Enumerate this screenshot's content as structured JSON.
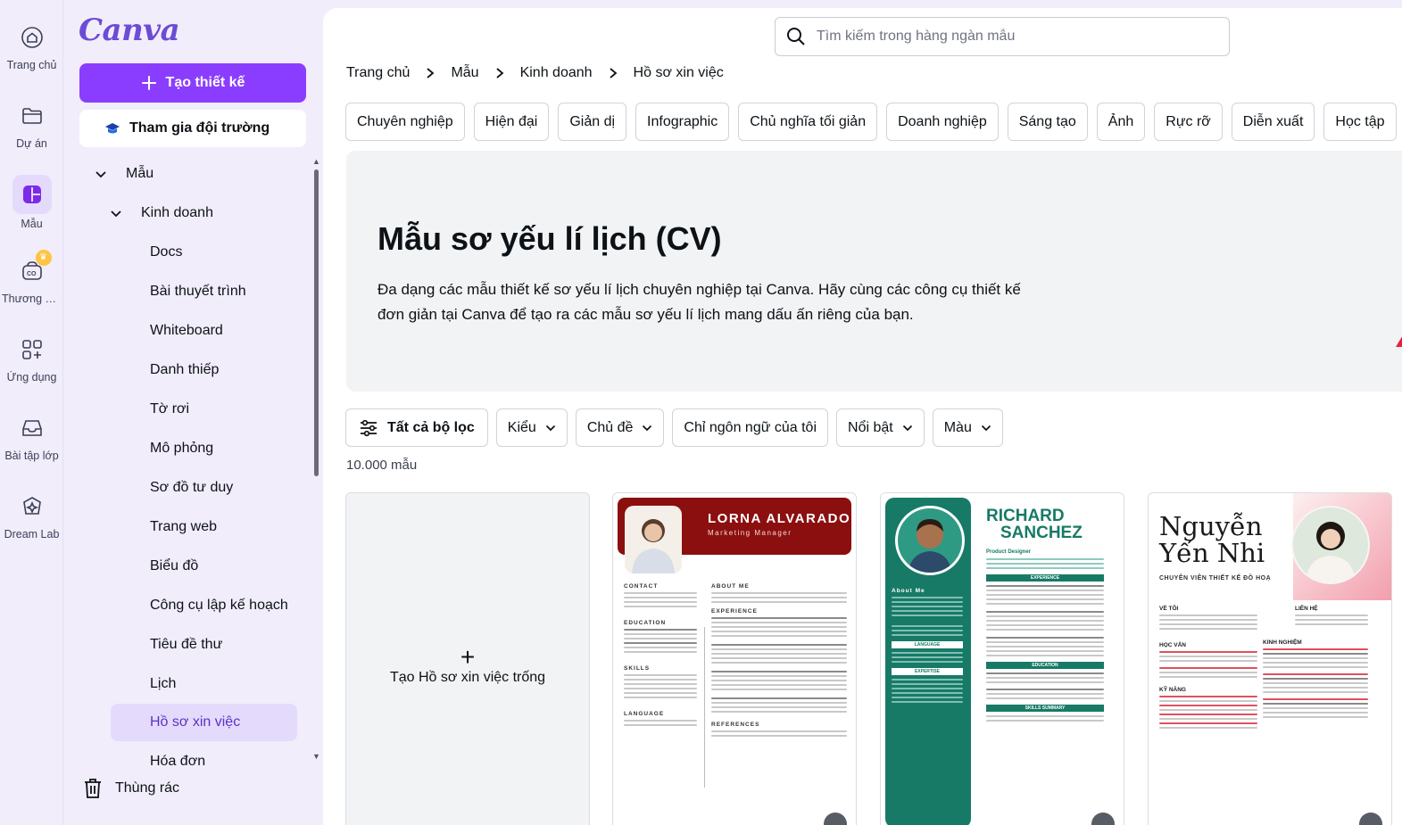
{
  "rail": {
    "items": [
      {
        "label": "Trang chủ",
        "icon": "home-icon"
      },
      {
        "label": "Dự án",
        "icon": "folder-icon"
      },
      {
        "label": "Mẫu",
        "icon": "templates-icon"
      },
      {
        "label": "Thương hi...",
        "icon": "brand-icon"
      },
      {
        "label": "Ứng dụng",
        "icon": "apps-icon"
      },
      {
        "label": "Bài tập lớp",
        "icon": "assignment-icon"
      },
      {
        "label": "Dream Lab",
        "icon": "dream-lab-icon"
      }
    ]
  },
  "sidebar": {
    "logo": "Canva",
    "create_button": "Tạo thiết kế",
    "team_button": "Tham gia đội trường",
    "tree": {
      "root": "Mẫu",
      "group": "Kinh doanh",
      "items": [
        "Docs",
        "Bài thuyết trình",
        "Whiteboard",
        "Danh thiếp",
        "Tờ rơi",
        "Mô phỏng",
        "Sơ đồ tư duy",
        "Trang web",
        "Biểu đồ",
        "Công cụ lập kế hoạch",
        "Tiêu đề thư",
        "Lịch",
        "Hồ sơ xin việc",
        "Hóa đơn"
      ],
      "selected": "Hồ sơ xin việc"
    },
    "trash": "Thùng rác"
  },
  "search": {
    "placeholder": "Tìm kiếm trong hàng ngàn mẫu",
    "value": ""
  },
  "breadcrumb": [
    "Trang chủ",
    "Mẫu",
    "Kinh doanh",
    "Hồ sơ xin việc"
  ],
  "chips": [
    "Chuyên nghiệp",
    "Hiện đại",
    "Giản dị",
    "Infographic",
    "Chủ nghĩa tối giản",
    "Doanh nghiệp",
    "Sáng tạo",
    "Ảnh",
    "Rực rỡ",
    "Diễn xuất",
    "Học tập"
  ],
  "hero": {
    "title": "Mẫu sơ yếu lí lịch (CV)",
    "description": "Đa dạng các mẫu thiết kế sơ yếu lí lịch chuyên nghiệp tại Canva. Hãy cùng các công cụ thiết kế đơn giản tại Canva để tạo ra các mẫu sơ yếu lí lịch mang dấu ấn riêng của bạn."
  },
  "filters": {
    "all": "Tất cả bộ lọc",
    "dropdowns": [
      "Kiểu",
      "Chủ đề"
    ],
    "my_language": "Chỉ ngôn ngữ của tôi",
    "dropdowns2": [
      "Nổi bật",
      "Màu"
    ]
  },
  "count": "10.000 mẫu",
  "cards": {
    "blank_label": "Tạo Hồ sơ xin việc trống",
    "resume1": {
      "name": "LORNA ALVARADO",
      "role": "Marketing Manager",
      "sections_left": [
        "CONTACT",
        "EDUCATION",
        "SKILLS",
        "LANGUAGE"
      ],
      "sections_right": [
        "ABOUT ME",
        "EXPERIENCE",
        "REFERENCES"
      ]
    },
    "resume2": {
      "name_line1": "RICHARD",
      "name_line2": "SANCHEZ",
      "role": "Product Designer",
      "left": [
        "About Me",
        "LANGUAGE",
        "EXPERTISE"
      ],
      "right": [
        "EXPERIENCE",
        "EDUCATION",
        "SKILLS SUMMARY"
      ]
    },
    "resume3": {
      "name_line1": "Nguyễn",
      "name_line2": "Yến Nhi",
      "role": "CHUYÊN VIÊN THIẾT KẾ ĐỒ HOẠ",
      "left": [
        "VỀ TÔI",
        "HỌC VẤN",
        "KỸ NĂNG"
      ],
      "right": [
        "LIÊN HỆ",
        "KINH NGHIỆM"
      ]
    }
  },
  "colors": {
    "brand": "#8b3dff",
    "accent_selected": "#e4dafc",
    "resume1_header": "#8c0f0f",
    "resume2_side": "#177a66",
    "resume3_accent": "#e0505f"
  }
}
